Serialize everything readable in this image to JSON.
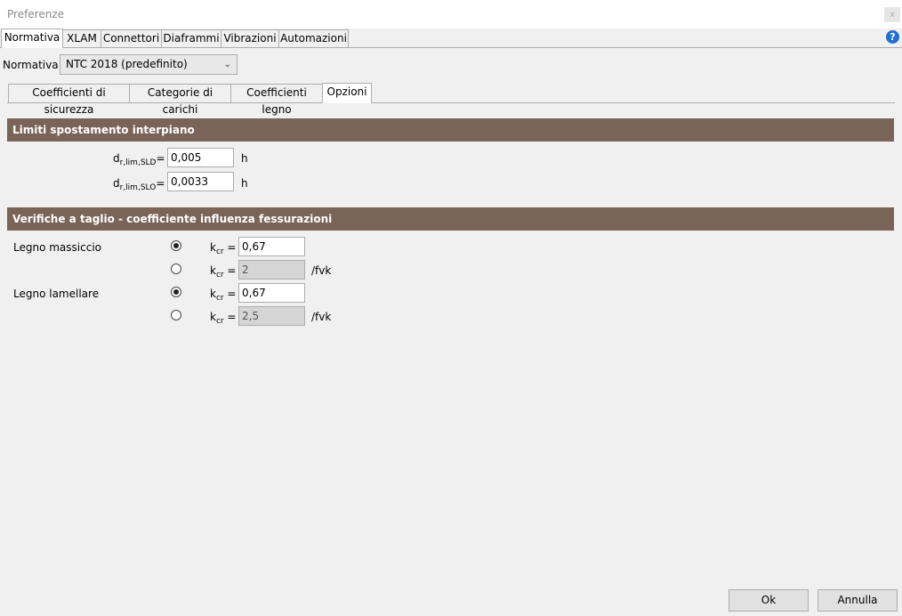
{
  "window": {
    "title": "Preferenze",
    "close_glyph": "x"
  },
  "main_tabs": [
    "Normativa",
    "XLAM",
    "Connettori",
    "Diaframmi",
    "Vibrazioni",
    "Automazioni"
  ],
  "normativa": {
    "label": "Normativa",
    "selected": "NTC 2018 (predefinito)"
  },
  "sub_tabs": [
    "Coefficienti di sicurezza",
    "Categorie di carichi",
    "Coefficienti legno",
    "Opzioni"
  ],
  "limiti": {
    "header": "Limiti spostamento interpiano",
    "rows": [
      {
        "symbol": "d",
        "subscript": "r,lim,SLD",
        "suffix": "=",
        "value": "0,005",
        "unit": "h"
      },
      {
        "symbol": "d",
        "subscript": "r,lim,SLO",
        "suffix": "=",
        "value": "0,0033",
        "unit": "h"
      }
    ]
  },
  "verifiche": {
    "header": "Verifiche a taglio - coefficiente influenza fessurazioni",
    "kcr_symbol": "k",
    "kcr_subscript": "cr",
    "kcr_suffix": " =",
    "groups": [
      {
        "label": "Legno massiccio",
        "options": [
          {
            "checked": true,
            "value": "0,67",
            "unit": ""
          },
          {
            "checked": false,
            "value": "2",
            "unit": "/fvk"
          }
        ]
      },
      {
        "label": "Legno lamellare",
        "options": [
          {
            "checked": true,
            "value": "0,67",
            "unit": ""
          },
          {
            "checked": false,
            "value": "2,5",
            "unit": "/fvk"
          }
        ]
      }
    ]
  },
  "buttons": {
    "ok": "Ok",
    "cancel": "Annulla"
  },
  "icons": {
    "help": "help-icon",
    "dropdown": "chevron-down-icon"
  },
  "colors": {
    "section_header_bg": "#7a6357",
    "help_icon": "#1e6fd0"
  }
}
